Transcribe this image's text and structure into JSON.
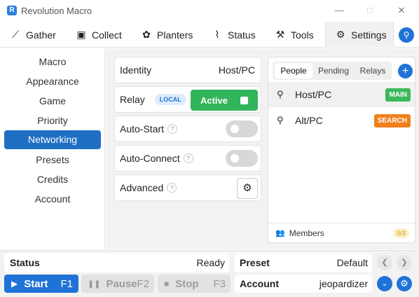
{
  "window": {
    "title": "Revolution Macro",
    "app_icon": "R"
  },
  "tabs": [
    {
      "label": "Gather",
      "icon": "gather-icon",
      "glyph": "⟋"
    },
    {
      "label": "Collect",
      "icon": "collect-icon",
      "glyph": "▣"
    },
    {
      "label": "Planters",
      "icon": "planters-icon",
      "glyph": "✿"
    },
    {
      "label": "Status",
      "icon": "status-icon",
      "glyph": "⌇"
    },
    {
      "label": "Tools",
      "icon": "tools-icon",
      "glyph": "⚒"
    },
    {
      "label": "Settings",
      "icon": "settings-icon",
      "glyph": "⚙"
    }
  ],
  "sidebar": {
    "items": [
      {
        "label": "Macro"
      },
      {
        "label": "Appearance"
      },
      {
        "label": "Game"
      },
      {
        "label": "Priority"
      },
      {
        "label": "Networking"
      },
      {
        "label": "Presets"
      },
      {
        "label": "Credits"
      },
      {
        "label": "Account"
      }
    ],
    "active_index": 4
  },
  "settings": {
    "identity": {
      "label": "Identity",
      "value": "Host/PC"
    },
    "relay": {
      "label": "Relay",
      "badge": "LOCAL",
      "button_label": "Active"
    },
    "auto_start": {
      "label": "Auto-Start",
      "on": false
    },
    "auto_connect": {
      "label": "Auto-Connect",
      "on": false
    },
    "advanced": {
      "label": "Advanced"
    },
    "help_glyph": "?"
  },
  "people_panel": {
    "tabs": [
      {
        "label": "People"
      },
      {
        "label": "Pending"
      },
      {
        "label": "Relays"
      }
    ],
    "active_tab": 0,
    "rows": [
      {
        "name": "Host/PC",
        "tag": "MAIN",
        "tag_color": "#3cb85c"
      },
      {
        "name": "Alt/PC",
        "tag": "SEARCH",
        "tag_color": "#f07f1c"
      }
    ],
    "members_label": "Members",
    "members_count": "0/3"
  },
  "bottom": {
    "status_label": "Status",
    "status_value": "Ready",
    "preset_label": "Preset",
    "preset_value": "Default",
    "account_label": "Account",
    "account_value": "jeopardizer",
    "start": {
      "label": "Start",
      "key": "F1"
    },
    "pause": {
      "label": "Pause",
      "key": "F2"
    },
    "stop": {
      "label": "Stop",
      "key": "F3"
    }
  },
  "colors": {
    "accent": "#1f73d6",
    "nav_active": "#1f6fc4",
    "active_green": "#32b45a"
  }
}
